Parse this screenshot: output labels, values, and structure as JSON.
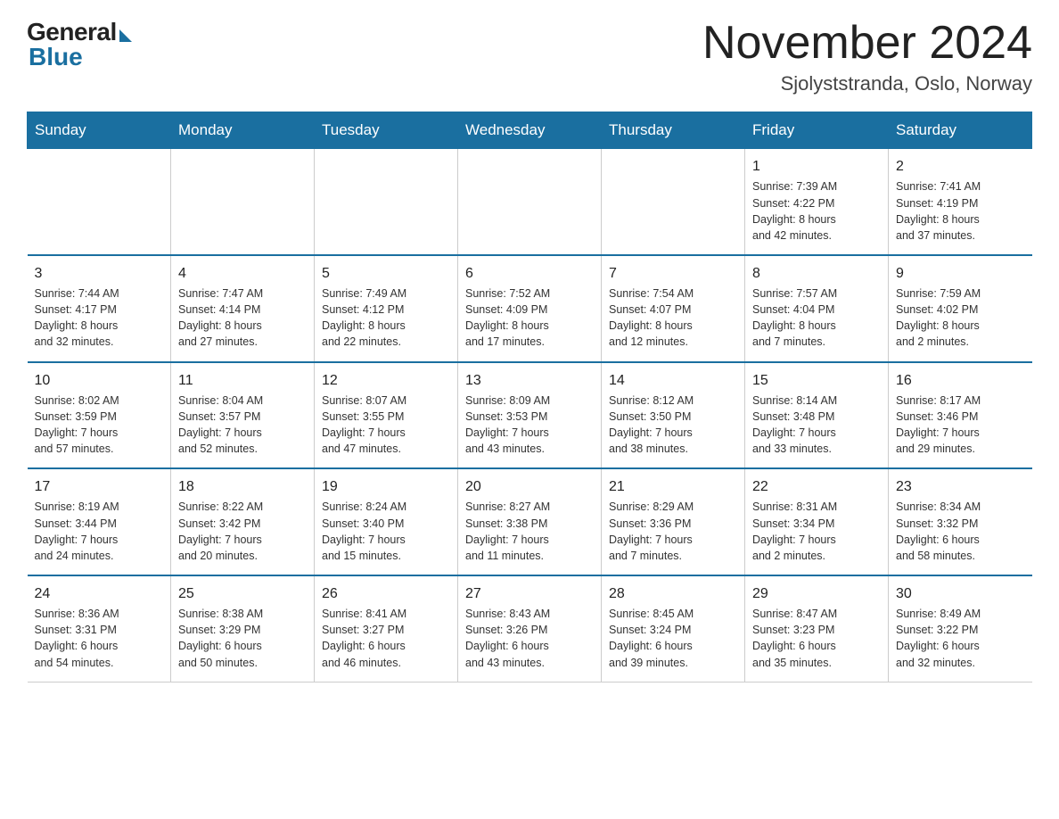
{
  "logo": {
    "general": "General",
    "blue": "Blue"
  },
  "title": "November 2024",
  "location": "Sjolyststranda, Oslo, Norway",
  "weekdays": [
    "Sunday",
    "Monday",
    "Tuesday",
    "Wednesday",
    "Thursday",
    "Friday",
    "Saturday"
  ],
  "weeks": [
    [
      {
        "day": "",
        "info": ""
      },
      {
        "day": "",
        "info": ""
      },
      {
        "day": "",
        "info": ""
      },
      {
        "day": "",
        "info": ""
      },
      {
        "day": "",
        "info": ""
      },
      {
        "day": "1",
        "info": "Sunrise: 7:39 AM\nSunset: 4:22 PM\nDaylight: 8 hours\nand 42 minutes."
      },
      {
        "day": "2",
        "info": "Sunrise: 7:41 AM\nSunset: 4:19 PM\nDaylight: 8 hours\nand 37 minutes."
      }
    ],
    [
      {
        "day": "3",
        "info": "Sunrise: 7:44 AM\nSunset: 4:17 PM\nDaylight: 8 hours\nand 32 minutes."
      },
      {
        "day": "4",
        "info": "Sunrise: 7:47 AM\nSunset: 4:14 PM\nDaylight: 8 hours\nand 27 minutes."
      },
      {
        "day": "5",
        "info": "Sunrise: 7:49 AM\nSunset: 4:12 PM\nDaylight: 8 hours\nand 22 minutes."
      },
      {
        "day": "6",
        "info": "Sunrise: 7:52 AM\nSunset: 4:09 PM\nDaylight: 8 hours\nand 17 minutes."
      },
      {
        "day": "7",
        "info": "Sunrise: 7:54 AM\nSunset: 4:07 PM\nDaylight: 8 hours\nand 12 minutes."
      },
      {
        "day": "8",
        "info": "Sunrise: 7:57 AM\nSunset: 4:04 PM\nDaylight: 8 hours\nand 7 minutes."
      },
      {
        "day": "9",
        "info": "Sunrise: 7:59 AM\nSunset: 4:02 PM\nDaylight: 8 hours\nand 2 minutes."
      }
    ],
    [
      {
        "day": "10",
        "info": "Sunrise: 8:02 AM\nSunset: 3:59 PM\nDaylight: 7 hours\nand 57 minutes."
      },
      {
        "day": "11",
        "info": "Sunrise: 8:04 AM\nSunset: 3:57 PM\nDaylight: 7 hours\nand 52 minutes."
      },
      {
        "day": "12",
        "info": "Sunrise: 8:07 AM\nSunset: 3:55 PM\nDaylight: 7 hours\nand 47 minutes."
      },
      {
        "day": "13",
        "info": "Sunrise: 8:09 AM\nSunset: 3:53 PM\nDaylight: 7 hours\nand 43 minutes."
      },
      {
        "day": "14",
        "info": "Sunrise: 8:12 AM\nSunset: 3:50 PM\nDaylight: 7 hours\nand 38 minutes."
      },
      {
        "day": "15",
        "info": "Sunrise: 8:14 AM\nSunset: 3:48 PM\nDaylight: 7 hours\nand 33 minutes."
      },
      {
        "day": "16",
        "info": "Sunrise: 8:17 AM\nSunset: 3:46 PM\nDaylight: 7 hours\nand 29 minutes."
      }
    ],
    [
      {
        "day": "17",
        "info": "Sunrise: 8:19 AM\nSunset: 3:44 PM\nDaylight: 7 hours\nand 24 minutes."
      },
      {
        "day": "18",
        "info": "Sunrise: 8:22 AM\nSunset: 3:42 PM\nDaylight: 7 hours\nand 20 minutes."
      },
      {
        "day": "19",
        "info": "Sunrise: 8:24 AM\nSunset: 3:40 PM\nDaylight: 7 hours\nand 15 minutes."
      },
      {
        "day": "20",
        "info": "Sunrise: 8:27 AM\nSunset: 3:38 PM\nDaylight: 7 hours\nand 11 minutes."
      },
      {
        "day": "21",
        "info": "Sunrise: 8:29 AM\nSunset: 3:36 PM\nDaylight: 7 hours\nand 7 minutes."
      },
      {
        "day": "22",
        "info": "Sunrise: 8:31 AM\nSunset: 3:34 PM\nDaylight: 7 hours\nand 2 minutes."
      },
      {
        "day": "23",
        "info": "Sunrise: 8:34 AM\nSunset: 3:32 PM\nDaylight: 6 hours\nand 58 minutes."
      }
    ],
    [
      {
        "day": "24",
        "info": "Sunrise: 8:36 AM\nSunset: 3:31 PM\nDaylight: 6 hours\nand 54 minutes."
      },
      {
        "day": "25",
        "info": "Sunrise: 8:38 AM\nSunset: 3:29 PM\nDaylight: 6 hours\nand 50 minutes."
      },
      {
        "day": "26",
        "info": "Sunrise: 8:41 AM\nSunset: 3:27 PM\nDaylight: 6 hours\nand 46 minutes."
      },
      {
        "day": "27",
        "info": "Sunrise: 8:43 AM\nSunset: 3:26 PM\nDaylight: 6 hours\nand 43 minutes."
      },
      {
        "day": "28",
        "info": "Sunrise: 8:45 AM\nSunset: 3:24 PM\nDaylight: 6 hours\nand 39 minutes."
      },
      {
        "day": "29",
        "info": "Sunrise: 8:47 AM\nSunset: 3:23 PM\nDaylight: 6 hours\nand 35 minutes."
      },
      {
        "day": "30",
        "info": "Sunrise: 8:49 AM\nSunset: 3:22 PM\nDaylight: 6 hours\nand 32 minutes."
      }
    ]
  ]
}
